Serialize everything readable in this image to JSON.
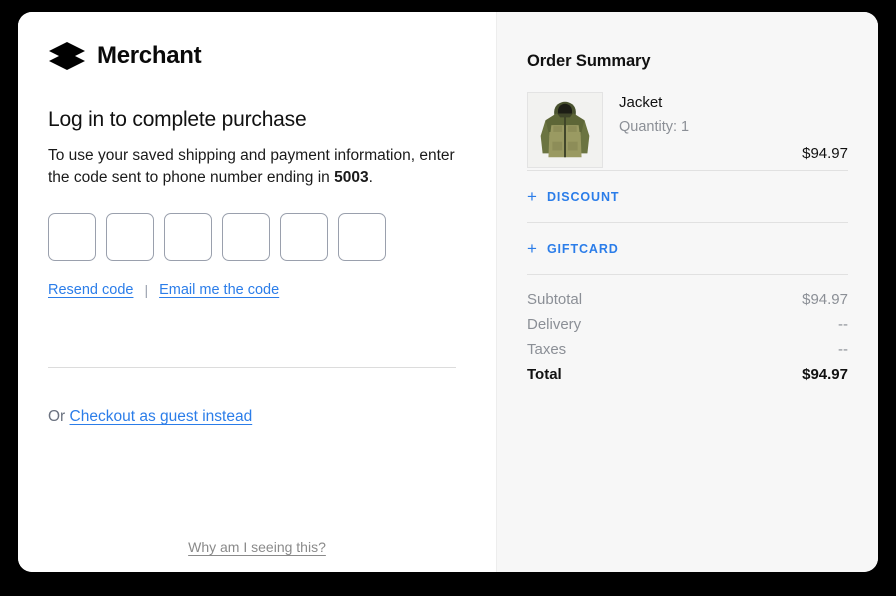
{
  "brand": {
    "name": "Merchant",
    "logo_icon": "layers-icon"
  },
  "login": {
    "headline": "Log in to complete purchase",
    "subcopy_prefix": "To use your saved shipping and payment information, enter the code sent to phone number ending in ",
    "phone_last4": "5003",
    "subcopy_suffix": ".",
    "otp": {
      "length": 6,
      "values": [
        "",
        "",
        "",
        "",
        "",
        ""
      ],
      "placeholder": ""
    },
    "resend_label": "Resend code",
    "separator": "|",
    "email_code_label": "Email me the code",
    "or_label": "Or",
    "guest_label": "Checkout as guest instead",
    "why_label": "Why am I seeing this?"
  },
  "order_summary": {
    "title": "Order Summary",
    "item": {
      "name": "Jacket",
      "quantity_label": "Quantity: 1",
      "price": "$94.97",
      "image_alt": "jacket-thumbnail"
    },
    "adjustments": [
      {
        "icon": "plus-icon",
        "label": "DISCOUNT",
        "name": "discount"
      },
      {
        "icon": "plus-icon",
        "label": "GIFTCARD",
        "name": "giftcard"
      }
    ],
    "totals": [
      {
        "label": "Subtotal",
        "value": "$94.97"
      },
      {
        "label": "Delivery",
        "value": "--"
      },
      {
        "label": "Taxes",
        "value": "--"
      }
    ],
    "grand_total": {
      "label": "Total",
      "value": "$94.97"
    }
  },
  "colors": {
    "link_blue": "#2b7de9",
    "panel_gray": "#f7f7f7",
    "text_muted": "#8b8f96",
    "backdrop": "#000000"
  }
}
